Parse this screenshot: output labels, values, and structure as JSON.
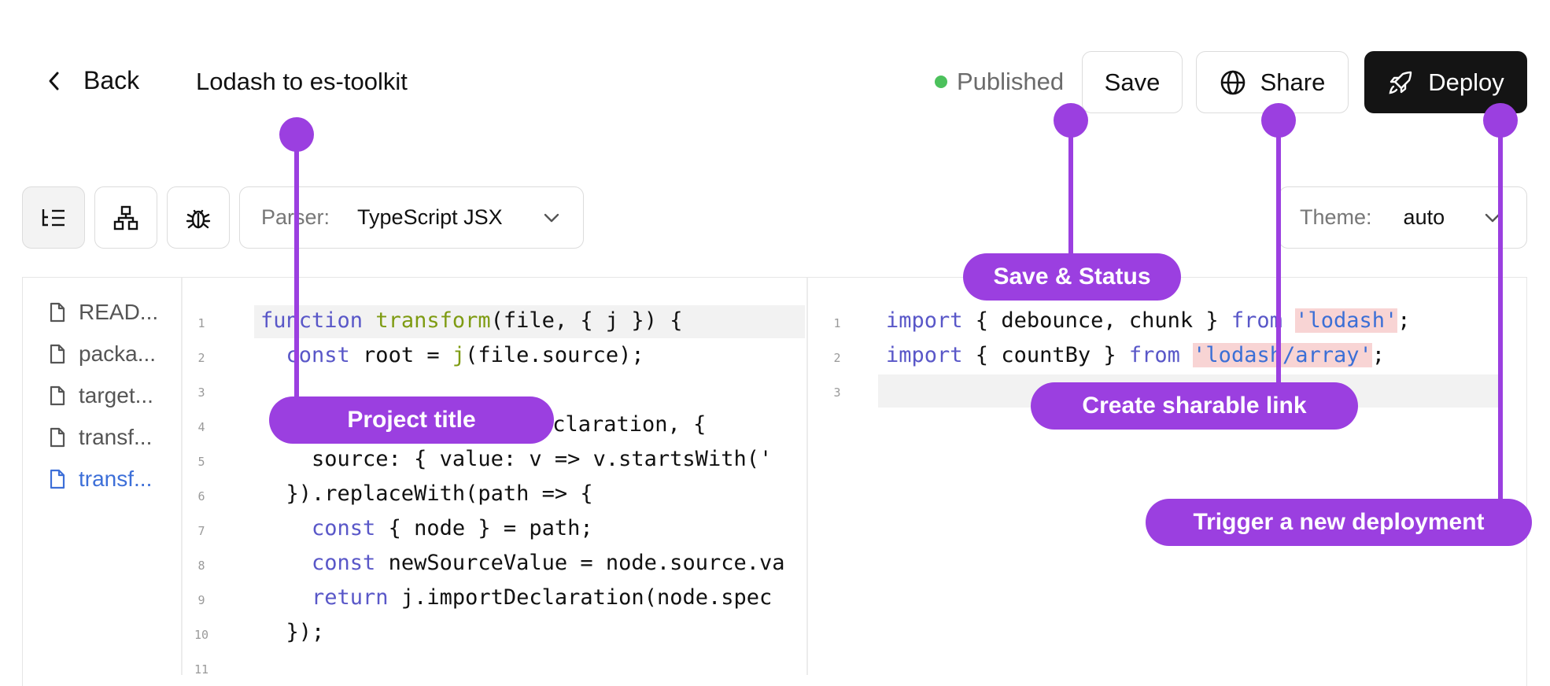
{
  "header": {
    "back_label": "Back",
    "project_title": "Lodash to es-toolkit",
    "status": "Published",
    "save_label": "Save",
    "share_label": "Share",
    "deploy_label": "Deploy"
  },
  "toolbar": {
    "parser_label": "Parser:",
    "parser_value": "TypeScript JSX",
    "theme_label": "Theme:",
    "theme_value": "auto"
  },
  "files": [
    "READ...",
    "packa...",
    "target...",
    "transf...",
    "transf..."
  ],
  "left_lines": [
    "1",
    "2",
    "3",
    "4",
    "5",
    "6",
    "7",
    "8",
    "9",
    "10",
    "11"
  ],
  "right_lines": [
    "1",
    "2",
    "3"
  ],
  "left_code": {
    "l5": "    source: { value: v => v.startsWith('",
    "l6": "  }).replaceWith(path => {",
    "l7_kw": "const",
    "l7_rest": " { node } = path;",
    "l8_kw": "const",
    "l8_rest": " newSourceValue = node.source.va",
    "l9_kw": "return",
    "l9_rest": " j.importDeclaration(node.spec",
    "l10": "  });"
  },
  "annotations": {
    "project_title": "Project title",
    "save_status": "Save & Status",
    "share": "Create sharable link",
    "deploy": "Trigger a new deployment"
  },
  "colors": {
    "accent": "#9b3fe0",
    "published_dot": "#4cc15c",
    "deploy_bg": "#141414"
  }
}
